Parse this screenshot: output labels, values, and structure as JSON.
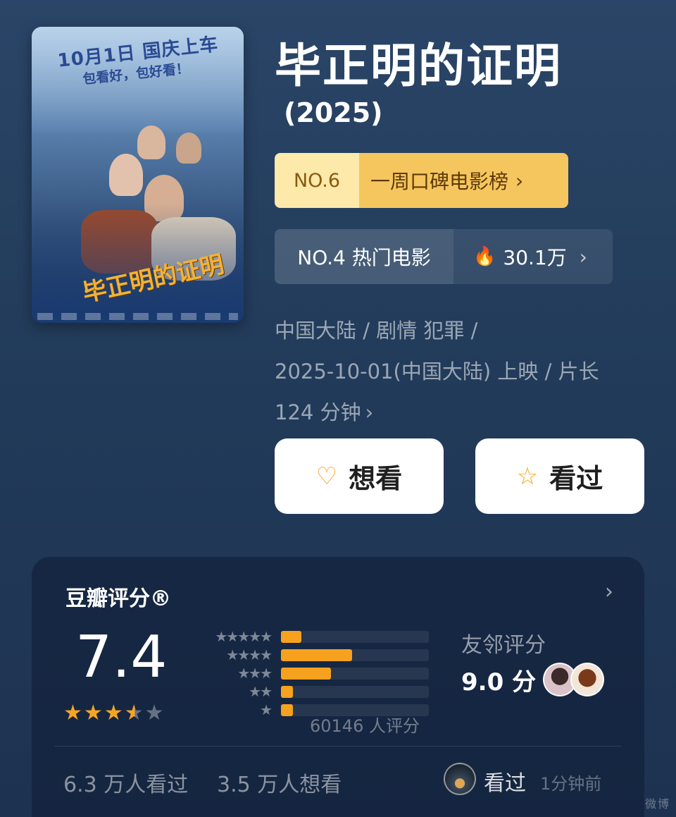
{
  "poster": {
    "tagline_top": "10月1日 国庆上车",
    "tagline_sub": "包看好，包好看！",
    "title_art": "毕正明的证明",
    "icon": "movie-poster-image"
  },
  "movie": {
    "title": "毕正明的证明",
    "year": "(2025)"
  },
  "rank_weekly": {
    "number": "NO.6",
    "label": "一周口碑电影榜",
    "chevron": "›"
  },
  "rank_hot": {
    "label": "NO.4 热门电影",
    "heat_icon": "🔥",
    "heat_value": "30.1万",
    "chevron": "›"
  },
  "meta": {
    "line1": "中国大陆 / 剧情 犯罪 /",
    "line2": "2025-10-01(中国大陆) 上映 / 片长",
    "line3": "124 分钟",
    "chevron": "›"
  },
  "actions": {
    "want_label": "想看",
    "want_icon": "♡",
    "seen_label": "看过",
    "seen_icon": "☆"
  },
  "rating": {
    "title": "豆瓣评分®",
    "chevron": "›",
    "score": "7.4",
    "stars_value": 3.5,
    "distribution": [
      {
        "stars": "★★★★★",
        "fraction": 0.14
      },
      {
        "stars": "★★★★",
        "fraction": 0.48
      },
      {
        "stars": "★★★",
        "fraction": 0.34
      },
      {
        "stars": "★★",
        "fraction": 0.08
      },
      {
        "stars": "★",
        "fraction": 0.08
      }
    ],
    "count_text": "60146 人评分",
    "friends_label": "友邻评分",
    "friends_score": "9.0 分"
  },
  "stats": {
    "seen": "6.3 万人看过",
    "want": "3.5 万人想看"
  },
  "activity": {
    "action": "看过",
    "time": "1分钟前"
  },
  "colors": {
    "accent": "#f5a524",
    "rank_badge": "#f6c65e",
    "background": "#243d5c"
  },
  "watermark": "微博"
}
